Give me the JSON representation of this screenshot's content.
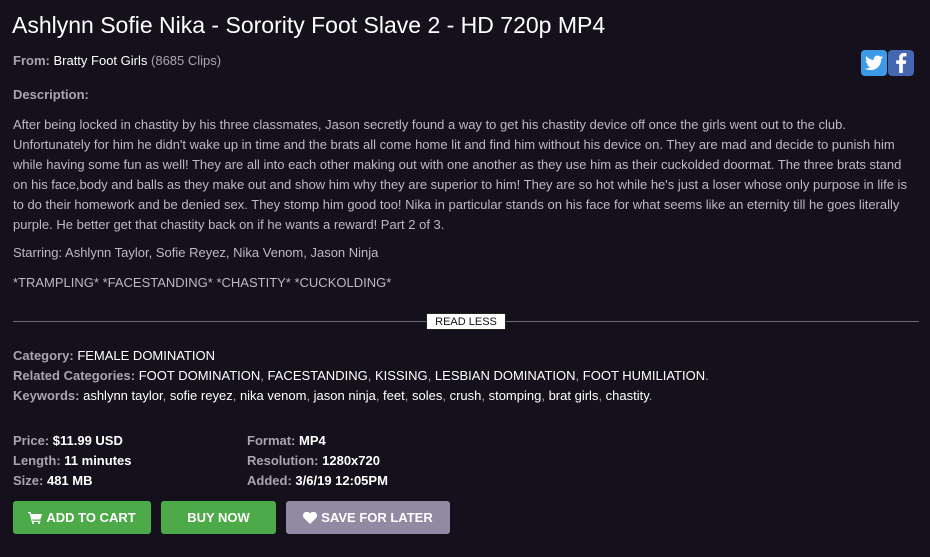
{
  "title": "Ashlynn Sofie Nika - Sorority Foot Slave 2 - HD 720p MP4",
  "from": {
    "label": "From:",
    "studio": "Bratty Foot Girls",
    "clips": "(8685 Clips)"
  },
  "social": {
    "twitter_icon": "twitter-icon",
    "facebook_icon": "facebook-icon"
  },
  "description": {
    "label": "Description:",
    "text": "After being locked in chastity by his three classmates, Jason secretly found a way to get his chastity device off once the girls went out to the club. Unfortunately for him he didn't wake up in time and the brats all come home lit and find him without his device on. They are mad and decide to punish him while having some fun as well! They are all into each other making out with one another as they use him as their cuckolded doormat. The three brats stand on his face,body and balls as they make out and show him why they are superior to him! They are so hot while he's just a loser whose only purpose in life is to do their homework and be denied sex. They stomp him good too! Nika in particular stands on his face for what seems like an eternity till he goes literally purple. He better get that chastity back on if he wants a reward! Part 2 of 3.",
    "starring": "Starring: Ashlynn Taylor, Sofie Reyez, Nika Venom, Jason Ninja",
    "tags": "*TRAMPLING* *FACESTANDING* *CHASTITY* *CUCKOLDING*"
  },
  "read_less": "READ LESS",
  "category": {
    "label": "Category:",
    "value": "FEMALE DOMINATION"
  },
  "related": {
    "label": "Related Categories:",
    "items": [
      "FOOT DOMINATION",
      "FACESTANDING",
      "KISSING",
      "LESBIAN DOMINATION",
      "FOOT HUMILIATION"
    ]
  },
  "keywords": {
    "label": "Keywords:",
    "items": [
      "ashlynn taylor",
      "sofie reyez",
      "nika venom",
      "jason ninja",
      "feet",
      "soles",
      "crush",
      "stomping",
      "brat girls",
      "chastity"
    ]
  },
  "info": {
    "price_label": "Price:",
    "price": "$11.99 USD",
    "length_label": "Length:",
    "length": "11 minutes",
    "size_label": "Size:",
    "size": "481 MB",
    "format_label": "Format:",
    "format": "MP4",
    "resolution_label": "Resolution:",
    "resolution": "1280x720",
    "added_label": "Added:",
    "added": "3/6/19 12:05PM"
  },
  "buttons": {
    "add_to_cart": "ADD TO CART",
    "buy_now": "BUY NOW",
    "save_for_later": "SAVE FOR LATER"
  },
  "colors": {
    "background": "#15111c",
    "green_button": "#4caa48",
    "save_button": "#928aa3",
    "twitter": "#3d9ae8",
    "facebook": "#4566b0"
  }
}
